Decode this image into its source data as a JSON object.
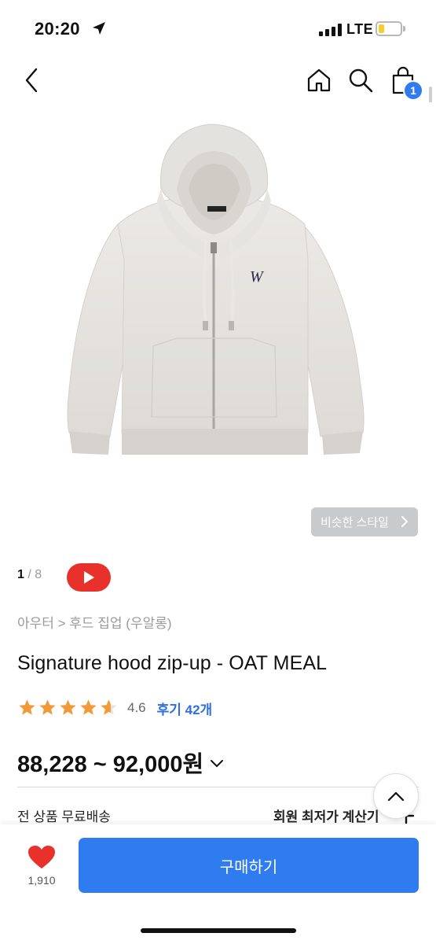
{
  "status_bar": {
    "time": "20:20",
    "network": "LTE",
    "icons": [
      "location-arrow-icon",
      "signal-icon",
      "battery-icon"
    ]
  },
  "nav": {
    "icons": [
      "back-icon",
      "home-icon",
      "search-icon",
      "cart-icon"
    ],
    "cart_count": "1"
  },
  "gallery": {
    "current": "1",
    "total": "/ 8",
    "similar_style_label": "비슷한 스타일"
  },
  "product": {
    "breadcrumb": "아우터 > 후드 집업 (우알롱)",
    "title": "Signature hood zip-up - OAT MEAL",
    "rating": "4.6",
    "rating_stars": 4.6,
    "review_label": "후기 42개",
    "price": "88,228 ~ 92,000원",
    "shipping": "전 상품 무료배송",
    "member_price_calc": "회원 최저가 계산기"
  },
  "bottom_bar": {
    "like_count": "1,910",
    "buy_label": "구매하기"
  },
  "colors": {
    "accent": "#2f7bf0",
    "link": "#2f6fe0",
    "star": "#f29a38",
    "youtube": "#e8312a",
    "heart": "#e8312a"
  }
}
